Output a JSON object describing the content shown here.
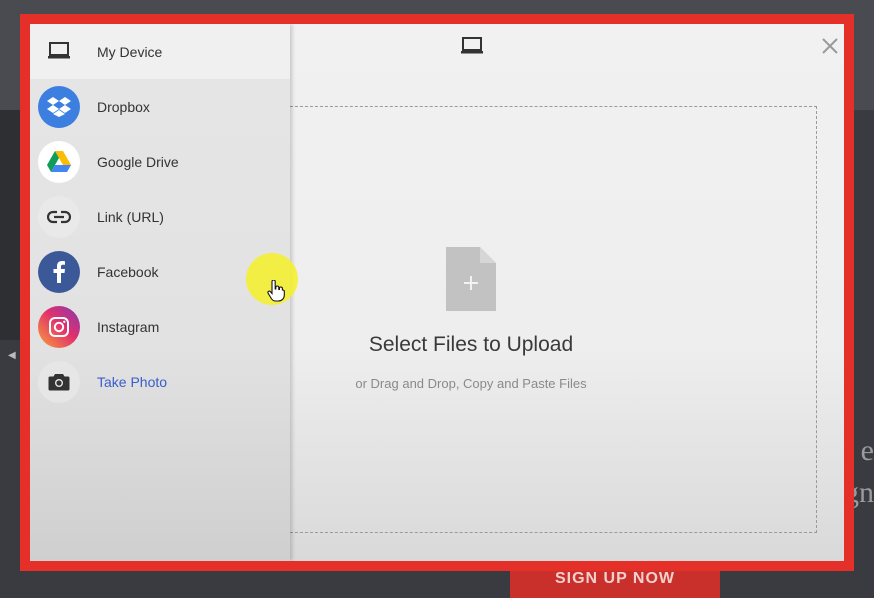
{
  "sidebar": {
    "items": [
      {
        "label": "My Device",
        "icon": "laptop-icon"
      },
      {
        "label": "Dropbox",
        "icon": "dropbox-icon"
      },
      {
        "label": "Google Drive",
        "icon": "google-drive-icon"
      },
      {
        "label": "Link (URL)",
        "icon": "link-icon"
      },
      {
        "label": "Facebook",
        "icon": "facebook-icon"
      },
      {
        "label": "Instagram",
        "icon": "instagram-icon"
      },
      {
        "label": "Take Photo",
        "icon": "camera-icon"
      }
    ]
  },
  "main": {
    "title": "Select Files to Upload",
    "subtitle": "or Drag and Drop, Copy and Paste Files"
  },
  "background": {
    "right_text": "e\ngn",
    "button_label": "SIGN UP NOW"
  },
  "colors": {
    "frame": "#e5302a",
    "link": "#3a5ccc",
    "dropbox": "#3d7fe0",
    "facebook": "#3b5998",
    "highlight": "#f6f028"
  }
}
